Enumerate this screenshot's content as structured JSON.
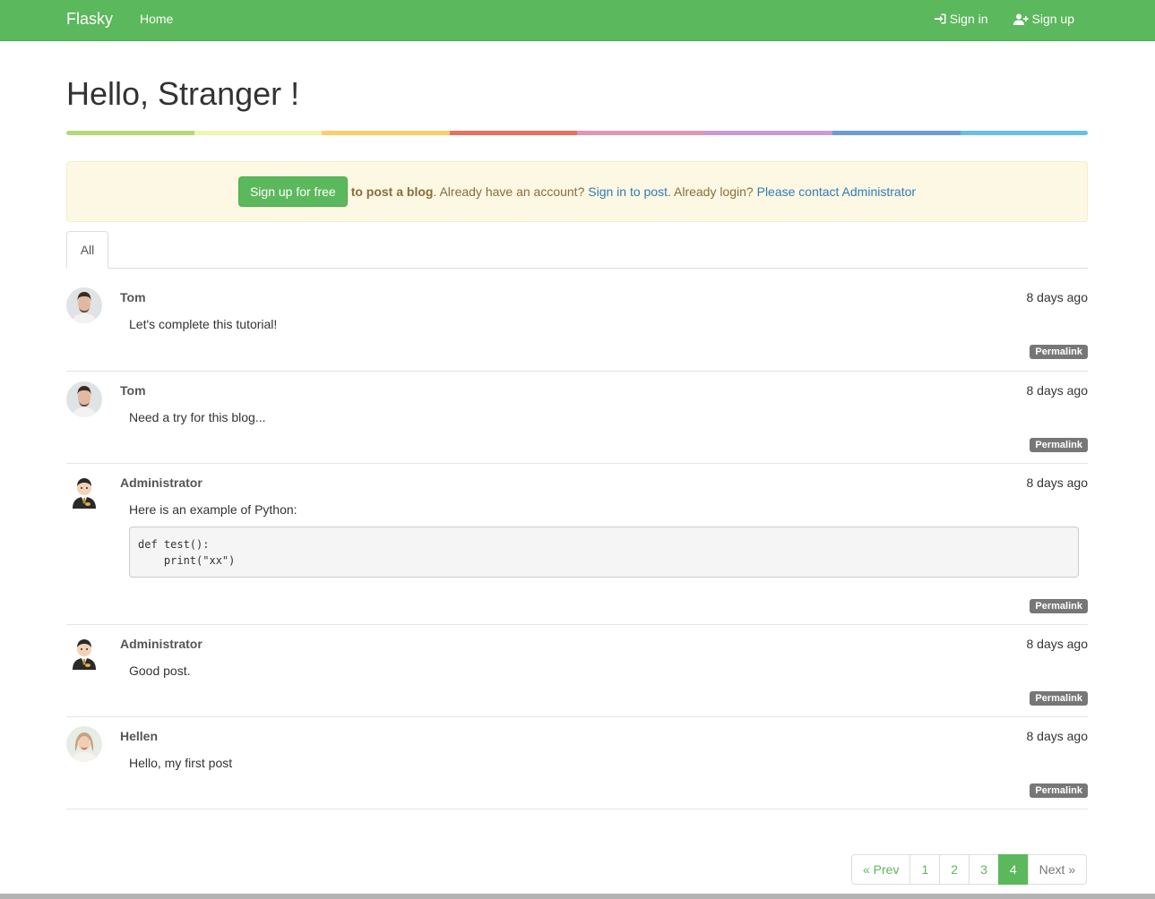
{
  "navbar": {
    "brand": "Flasky",
    "home": "Home",
    "sign_in": "Sign in",
    "sign_up": "Sign up",
    "sign_in_icon": "sign-in-icon",
    "sign_up_icon": "user-plus-icon"
  },
  "header": {
    "title": "Hello, Stranger !"
  },
  "alert": {
    "button": "Sign up for free",
    "bold_text": "to post a blog",
    "text1": ". Already have an account? ",
    "link1": "Sign in to post",
    "text2": ". Already login? ",
    "link2": "Please contact Administrator"
  },
  "tabs": [
    {
      "label": "All",
      "active": true
    }
  ],
  "posts": [
    {
      "author": "Tom",
      "date": "8 days ago",
      "body": "Let's complete this tutorial!",
      "permalink": "Permalink",
      "avatar": "man-avatar"
    },
    {
      "author": "Tom",
      "date": "8 days ago",
      "body": "Need a try for this blog...",
      "permalink": "Permalink",
      "avatar": "man-avatar"
    },
    {
      "author": "Administrator",
      "date": "8 days ago",
      "body": "Here is an example of Python:",
      "code": "def test():\n    print(\"xx\")",
      "permalink": "Permalink",
      "avatar": "admin-avatar"
    },
    {
      "author": "Administrator",
      "date": "8 days ago",
      "body": "Good post.",
      "permalink": "Permalink",
      "avatar": "admin-avatar"
    },
    {
      "author": "Hellen",
      "date": "8 days ago",
      "body": "Hello, my first post",
      "permalink": "Permalink",
      "avatar": "woman-avatar"
    }
  ],
  "pagination": {
    "prev": "« Prev",
    "pages": [
      "1",
      "2",
      "3",
      "4"
    ],
    "active": "4",
    "next": "Next »"
  },
  "colors": {
    "brand": "#5cb85c",
    "alert_bg": "#fcf8e3",
    "link": "#337ab7",
    "rainbow": [
      "#b5d97a",
      "#f0f5b3",
      "#fbcf6e",
      "#e8705f",
      "#e095b9",
      "#c99ad6",
      "#6e9bd6",
      "#68c0e3"
    ]
  }
}
